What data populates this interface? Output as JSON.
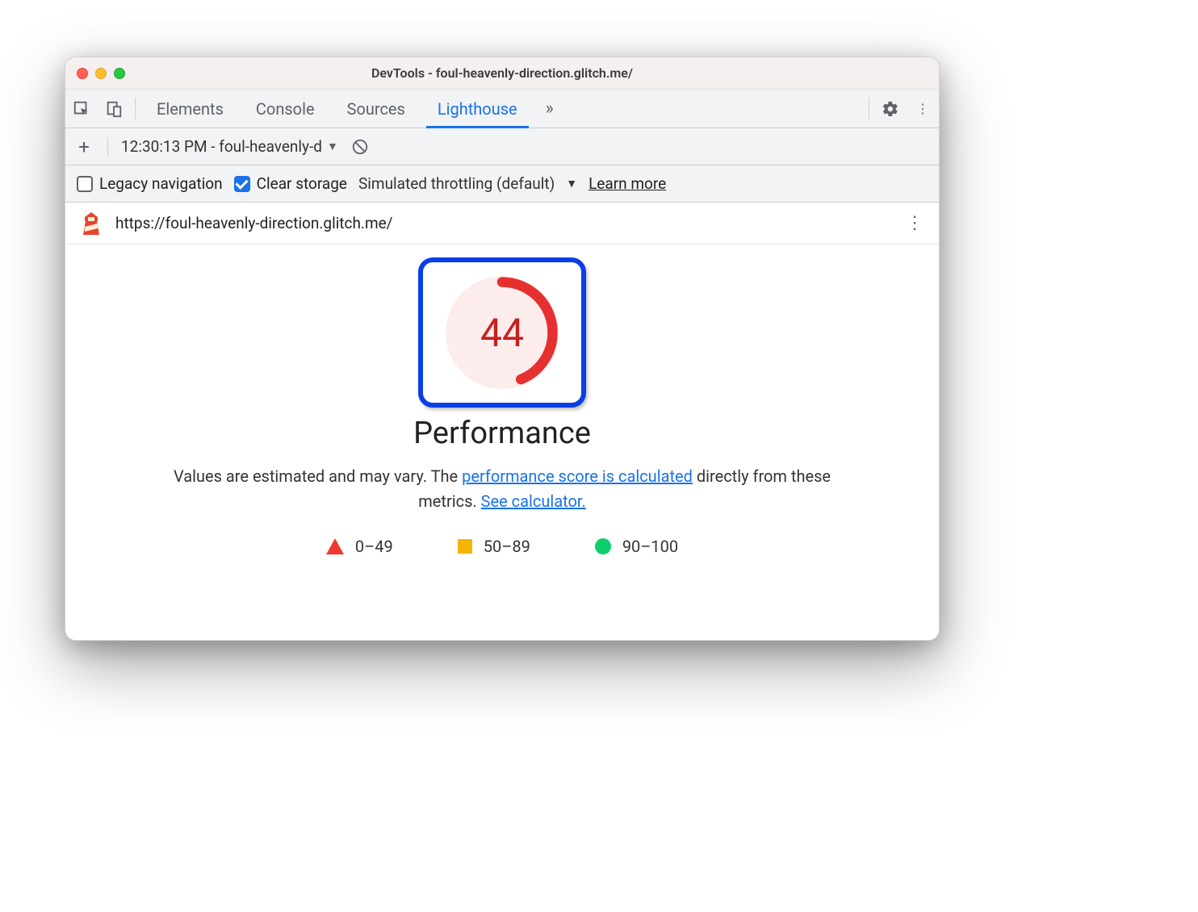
{
  "window": {
    "title": "DevTools - foul-heavenly-direction.glitch.me/"
  },
  "tabs": {
    "items": [
      "Elements",
      "Console",
      "Sources",
      "Lighthouse"
    ],
    "active_index": 3
  },
  "subbar": {
    "report_label": "12:30:13 PM - foul-heavenly-d"
  },
  "options": {
    "legacy_label": "Legacy navigation",
    "legacy_checked": false,
    "clear_label": "Clear storage",
    "clear_checked": true,
    "throttling_label": "Simulated throttling (default)",
    "learn_more": "Learn more"
  },
  "url": "https://foul-heavenly-direction.glitch.me/",
  "report": {
    "score": "44",
    "category": "Performance",
    "desc_pre": "Values are estimated and may vary. The ",
    "link1": "performance score is calculated",
    "desc_mid": " directly from these metrics. ",
    "link2": "See calculator.",
    "legend": {
      "fail": "0–49",
      "avg": "50–89",
      "pass": "90–100"
    }
  },
  "colors": {
    "accent": "#1a73e8",
    "fail": "#eb3b2f",
    "avg": "#f4b400",
    "pass": "#0cce6b",
    "highlight_border": "#0b3fe6"
  }
}
